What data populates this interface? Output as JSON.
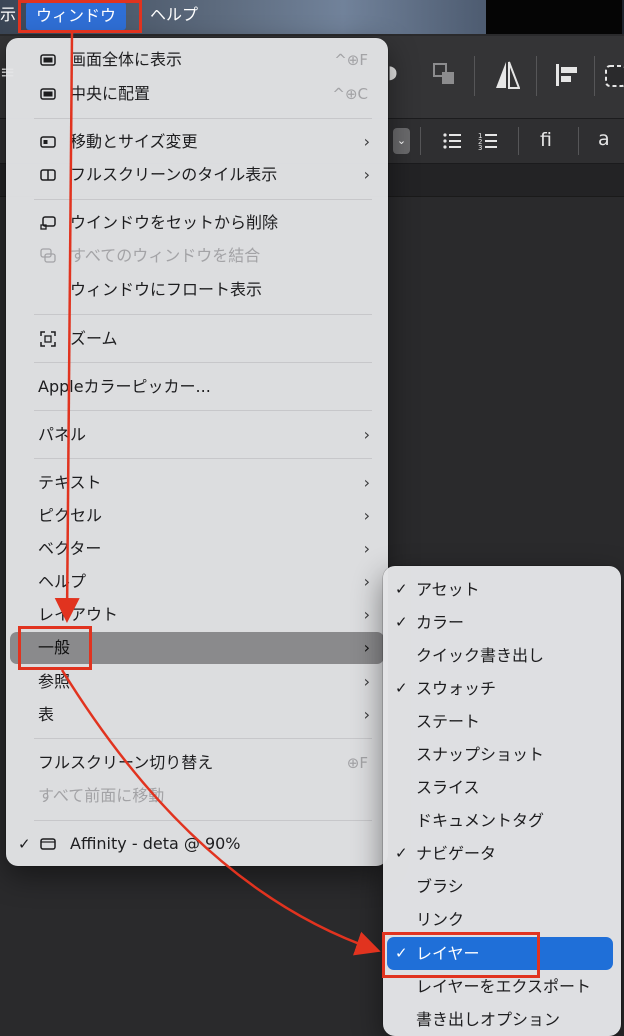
{
  "menubar": {
    "left_fragment": "示",
    "window_menu": "ウィンドウ",
    "help_menu": "ヘルプ"
  },
  "toolbar": {
    "ligature_label": "fi",
    "font_label": "a"
  },
  "window_menu": {
    "items": [
      {
        "label": "画面全体に表示",
        "shortcut": "^⊕F",
        "icon": "fullscreen-window-icon"
      },
      {
        "label": "中央に配置",
        "shortcut": "^⊕C",
        "icon": "center-window-icon"
      },
      {
        "label": "移動とサイズ変更",
        "icon": "move-resize-icon"
      },
      {
        "label": "フルスクリーンのタイル表示",
        "icon": "tile-icon"
      },
      {
        "label": "ウインドウをセットから削除",
        "icon": "remove-window-icon"
      },
      {
        "label": "すべてのウィンドウを結合",
        "icon": "merge-windows-icon"
      },
      {
        "label": "ウィンドウにフロート表示"
      },
      {
        "label": "ズーム",
        "icon": "zoom-icon"
      },
      {
        "label": "Appleカラーピッカー..."
      },
      {
        "label": "パネル"
      },
      {
        "label": "テキスト"
      },
      {
        "label": "ピクセル"
      },
      {
        "label": "ベクター"
      },
      {
        "label": "ヘルプ"
      },
      {
        "label": "レイアウト"
      },
      {
        "label": "一般"
      },
      {
        "label": "参照"
      },
      {
        "label": "表"
      },
      {
        "label": "フルスクリーン切り替え",
        "shortcut": "⊕F"
      },
      {
        "label": "すべて前面に移動"
      },
      {
        "label": "Affinity - deta @ 90%",
        "checked": true
      }
    ]
  },
  "submenu": {
    "items": [
      {
        "label": "アセット",
        "checked": true
      },
      {
        "label": "カラー",
        "checked": true
      },
      {
        "label": "クイック書き出し",
        "checked": false
      },
      {
        "label": "スウォッチ",
        "checked": true
      },
      {
        "label": "ステート",
        "checked": false
      },
      {
        "label": "スナップショット",
        "checked": false
      },
      {
        "label": "スライス",
        "checked": false
      },
      {
        "label": "ドキュメントタグ",
        "checked": false
      },
      {
        "label": "ナビゲータ",
        "checked": true
      },
      {
        "label": "ブラシ",
        "checked": false
      },
      {
        "label": "リンク",
        "checked": false
      },
      {
        "label": "レイヤー",
        "checked": true
      },
      {
        "label": "レイヤーをエクスポート",
        "checked": false
      },
      {
        "label": "書き出しオプション",
        "checked": false
      }
    ]
  },
  "annotation_color": "#e1331f",
  "highlight_color": "#1f6fd8"
}
